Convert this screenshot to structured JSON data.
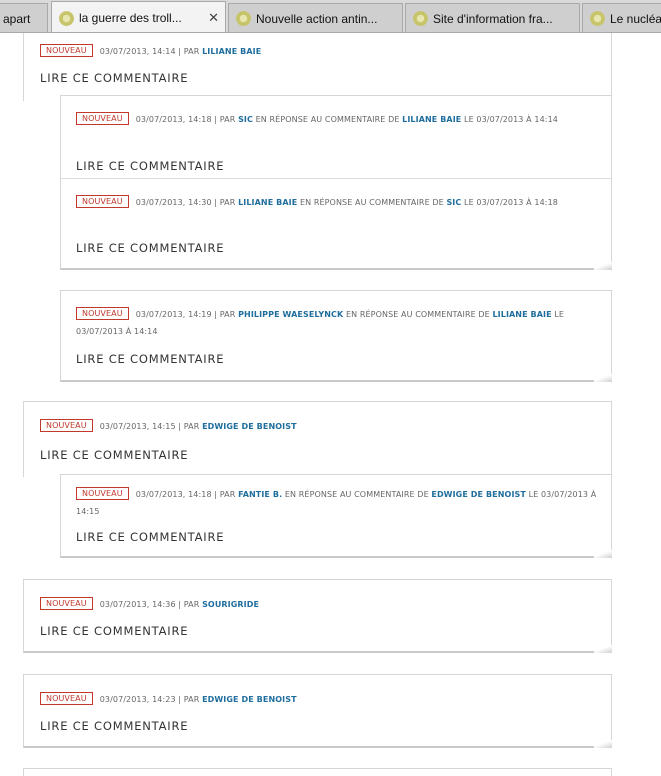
{
  "tabs": [
    {
      "label": "apart",
      "active": false
    },
    {
      "label": "la guerre des troll...",
      "active": true,
      "close": "✕"
    },
    {
      "label": "Nouvelle action antin...",
      "active": false
    },
    {
      "label": "Site d'information fra...",
      "active": false
    },
    {
      "label": "Le nucléa",
      "active": false
    }
  ],
  "labels": {
    "badge": "NOUVEAU",
    "read": "LIRE CE COMMENTAIRE",
    "by": "PAR",
    "reply": "EN RÉPONSE AU COMMENTAIRE DE",
    "on": "LE",
    "at": "À"
  },
  "comments": [
    {
      "date": "03/07/2013, 14:14",
      "author": "LILIANE BAIE"
    },
    {
      "date": "03/07/2013, 14:18",
      "author": "SIC",
      "reply_to": "LILIANE BAIE",
      "reply_date": "03/07/2013",
      "reply_time": "14:14"
    },
    {
      "date": "03/07/2013, 14:30",
      "author": "LILIANE BAIE",
      "reply_to": "SIC",
      "reply_date": "03/07/2013",
      "reply_time": "14:18"
    },
    {
      "date": "03/07/2013, 14:19",
      "author": "PHILIPPE WAESELYNCK",
      "reply_to": "LILIANE BAIE",
      "reply_date": "03/07/2013",
      "reply_time": "14:14"
    },
    {
      "date": "03/07/2013, 14:15",
      "author": "EDWIGE DE BENOIST"
    },
    {
      "date": "03/07/2013, 14:18",
      "author": "FANTIE B.",
      "reply_to": "EDWIGE DE BENOIST",
      "reply_date": "03/07/2013",
      "reply_time": "14:15"
    },
    {
      "date": "03/07/2013, 14:36",
      "author": "SOURIGRIDE"
    },
    {
      "date": "03/07/2013, 14:23",
      "author": "EDWIGE DE BENOIST"
    }
  ],
  "colors": {
    "badge": "#c0392b",
    "author": "#1f6e9e"
  }
}
